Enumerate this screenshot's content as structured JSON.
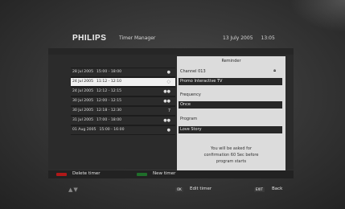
{
  "header": {
    "brand": "PHILIPS",
    "title": "Timer Manager",
    "date": "13 July 2005",
    "time": "13:05"
  },
  "timers": [
    {
      "date": "28 Jul 2005",
      "time": "15:00 - 18:00",
      "icon": "single-dot-icon",
      "glyph": "●"
    },
    {
      "date": "24 Jul 2005",
      "time": "11:12 - 12:10",
      "icon": "once-circle-icon",
      "glyph": "◌"
    },
    {
      "date": "24 Jul 2005",
      "time": "12:12 - 12:15",
      "icon": "double-dot-icon",
      "glyph": "●●"
    },
    {
      "date": "30 Jul 2005",
      "time": "12:00 - 12:15",
      "icon": "double-dot-icon",
      "glyph": "●●"
    },
    {
      "date": "30 Jul 2005",
      "time": "12:18 - 12:30",
      "icon": "weekly-icon",
      "glyph": "7"
    },
    {
      "date": "31 Jul 2005",
      "time": "17:00 - 18:00",
      "icon": "double-dot-icon",
      "glyph": "●●"
    },
    {
      "date": "01 Aug 2005",
      "time": "15:00 - 16:00",
      "icon": "single-dot-icon",
      "glyph": "●"
    }
  ],
  "selected_index": 1,
  "detail": {
    "heading": "Reminder",
    "channel": "Channel 013",
    "lock_icon": "lock-icon",
    "channel_value": "Promo Interactive TV",
    "frequency_label": "Frequency",
    "frequency_value": "Once",
    "program_label": "Program",
    "program_value": "Love Story",
    "note_line1": "You will be asked for",
    "note_line2": "confirmation 60 Sec before",
    "note_line3": "program starts"
  },
  "footer": {
    "red_key_color": "#b01818",
    "green_key_color": "#1f6e2a",
    "delete_label": "Delete timer",
    "new_label": "New timer",
    "nav_arrows": "▲▼",
    "ok_key": "OK",
    "edit_label": "Edit timer",
    "exit_key": "EXIT",
    "back_label": "Back"
  }
}
